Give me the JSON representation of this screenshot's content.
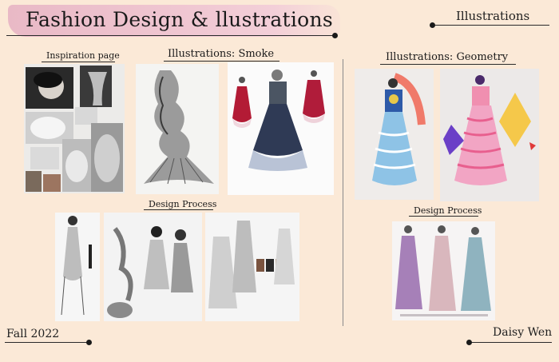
{
  "header": {
    "title": "Fashion Design & llustrations",
    "section": "Illustrations"
  },
  "left": {
    "inspiration_label": "Inspiration page",
    "smoke_label": "Illustrations: Smoke",
    "process_label": "Design Process"
  },
  "right": {
    "geometry_label": "Illustrations: Geometry",
    "process_label": "Design Process"
  },
  "footer": {
    "date": "Fall 2022",
    "author": "Daisy Wen"
  },
  "colors": {
    "background": "#fbe9d7",
    "brush": "#efc3cf",
    "text": "#1f1f1f"
  }
}
